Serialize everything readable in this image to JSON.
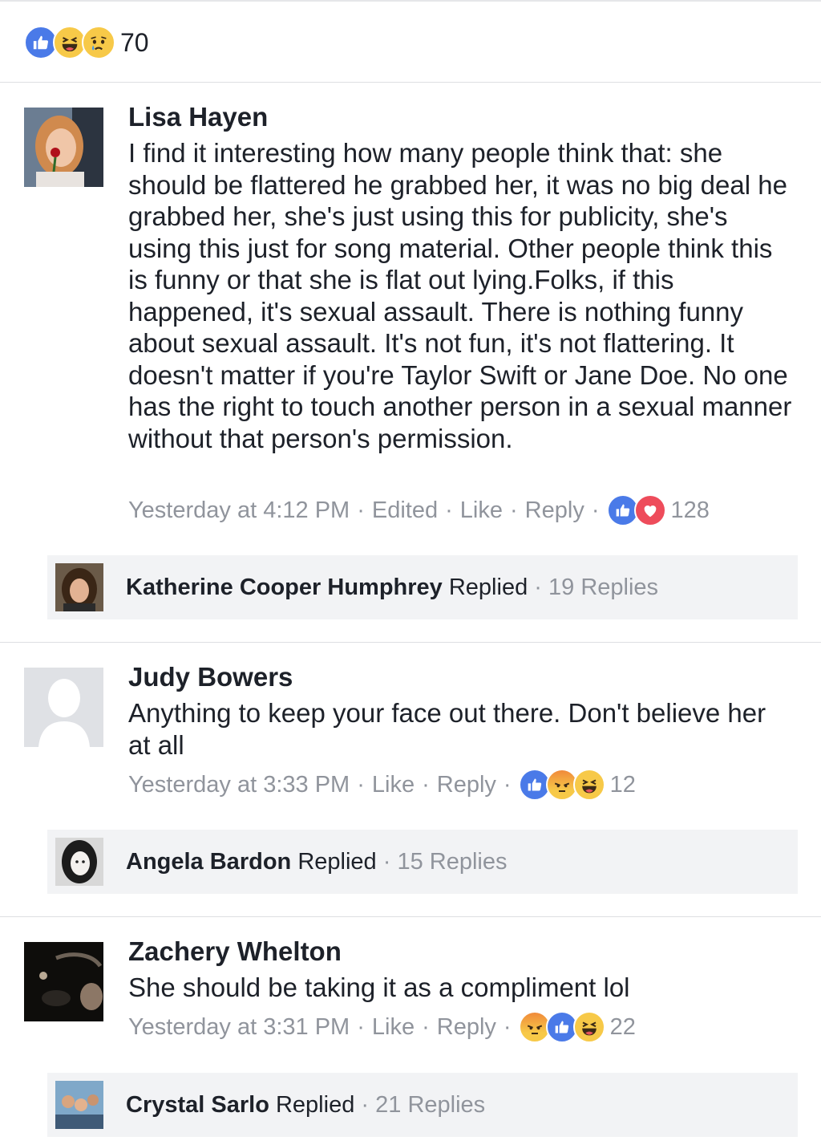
{
  "reactions_summary": {
    "icons": [
      "like-icon",
      "haha-icon",
      "sad-icon"
    ],
    "count": "70"
  },
  "colors": {
    "like_blue": "#4a7ae8",
    "love_red": "#ee4c5b",
    "emoji_yellow": "#f7c948",
    "meta_gray": "#90949c",
    "text_dark": "#1d2129",
    "reply_bar_bg": "#f2f3f5"
  },
  "comments": [
    {
      "author": "Lisa Hayen",
      "text": "I find it interesting how many people think that: she should be flattered he grabbed her, it was no big deal he grabbed her, she's just using this for publicity, she's using this just for song material. Other people think this is funny or that she is flat out lying.Folks, if this happened, it's sexual assault. There is nothing funny about sexual assault. It's not fun, it's not flattering. It doesn't matter if you're Taylor Swift or Jane Doe. No one has the right to touch another person in a sexual manner without that person's permission.",
      "time": "Yesterday at 4:12 PM",
      "edited": "Edited",
      "like": "Like",
      "reply": "Reply",
      "reactions": [
        "like-icon",
        "love-icon"
      ],
      "reaction_count": "128",
      "replies": {
        "name": "Katherine Cooper Humphrey",
        "action": "Replied",
        "count": "19 Replies"
      }
    },
    {
      "author": "Judy Bowers",
      "text": "Anything to keep your face out there. Don't believe her at all",
      "time": "Yesterday at 3:33 PM",
      "like": "Like",
      "reply": "Reply",
      "reactions": [
        "like-icon",
        "angry-icon",
        "haha-icon"
      ],
      "reaction_count": "12",
      "replies": {
        "name": "Angela Bardon",
        "action": "Replied",
        "count": "15 Replies"
      }
    },
    {
      "author": "Zachery Whelton",
      "text": "She should be taking it as a compliment lol",
      "time": "Yesterday at 3:31 PM",
      "like": "Like",
      "reply": "Reply",
      "reactions": [
        "angry-icon",
        "like-icon",
        "haha-icon"
      ],
      "reaction_count": "22",
      "replies": {
        "name": "Crystal Sarlo",
        "action": "Replied",
        "count": "21 Replies"
      }
    }
  ],
  "separator": "·"
}
